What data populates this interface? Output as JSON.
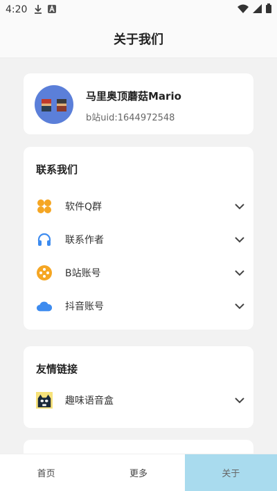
{
  "status_bar": {
    "time": "4:20"
  },
  "header": {
    "title": "关于我们"
  },
  "profile": {
    "name": "马里奥顶蘑菇Mario",
    "uid": "b站uid:1644972548"
  },
  "contact": {
    "title": "联系我们",
    "items": [
      {
        "label": "软件Q群",
        "icon": "clover-icon"
      },
      {
        "label": "联系作者",
        "icon": "headphones-icon"
      },
      {
        "label": "B站账号",
        "icon": "gamepad-icon"
      },
      {
        "label": "抖音账号",
        "icon": "cloud-icon"
      }
    ]
  },
  "links": {
    "title": "友情链接",
    "items": [
      {
        "label": "趣味语音盒",
        "icon": "cat-avatar-icon"
      }
    ]
  },
  "bottom_nav": {
    "home": "首页",
    "more": "更多",
    "about": "关于"
  },
  "colors": {
    "accent": "#a9dbee",
    "orange": "#f5a623",
    "blue": "#3d8bef"
  }
}
